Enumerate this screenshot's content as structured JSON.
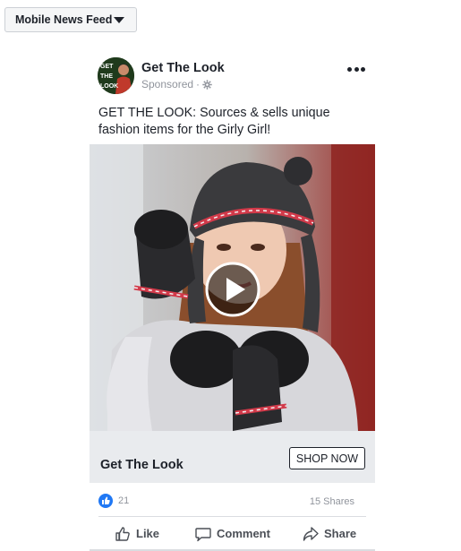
{
  "placement": {
    "label": "Mobile News Feed",
    "icon": "caret-down-icon"
  },
  "post": {
    "page_name": "Get The Look",
    "avatar_text": [
      "GET",
      "THE",
      "LOOK"
    ],
    "sponsored_label": "Sponsored",
    "separator": "·",
    "audience_icon": "gear-icon",
    "more_icon": "more-options-icon",
    "text": "GET THE LOOK: Sources & sells unique fashion items for the Girly Girl!",
    "media": {
      "type": "video",
      "play_icon": "play-icon"
    },
    "cta": {
      "title": "Get The Look",
      "button_label": "SHOP NOW"
    },
    "reactions": {
      "icon": "like-reaction-icon",
      "count": "21"
    },
    "shares": "15 Shares",
    "actions": {
      "like": "Like",
      "comment": "Comment",
      "share": "Share"
    }
  },
  "colors": {
    "like_blue": "#2078f4",
    "cta_background": "#e9ebee",
    "muted_text": "#90949c"
  }
}
